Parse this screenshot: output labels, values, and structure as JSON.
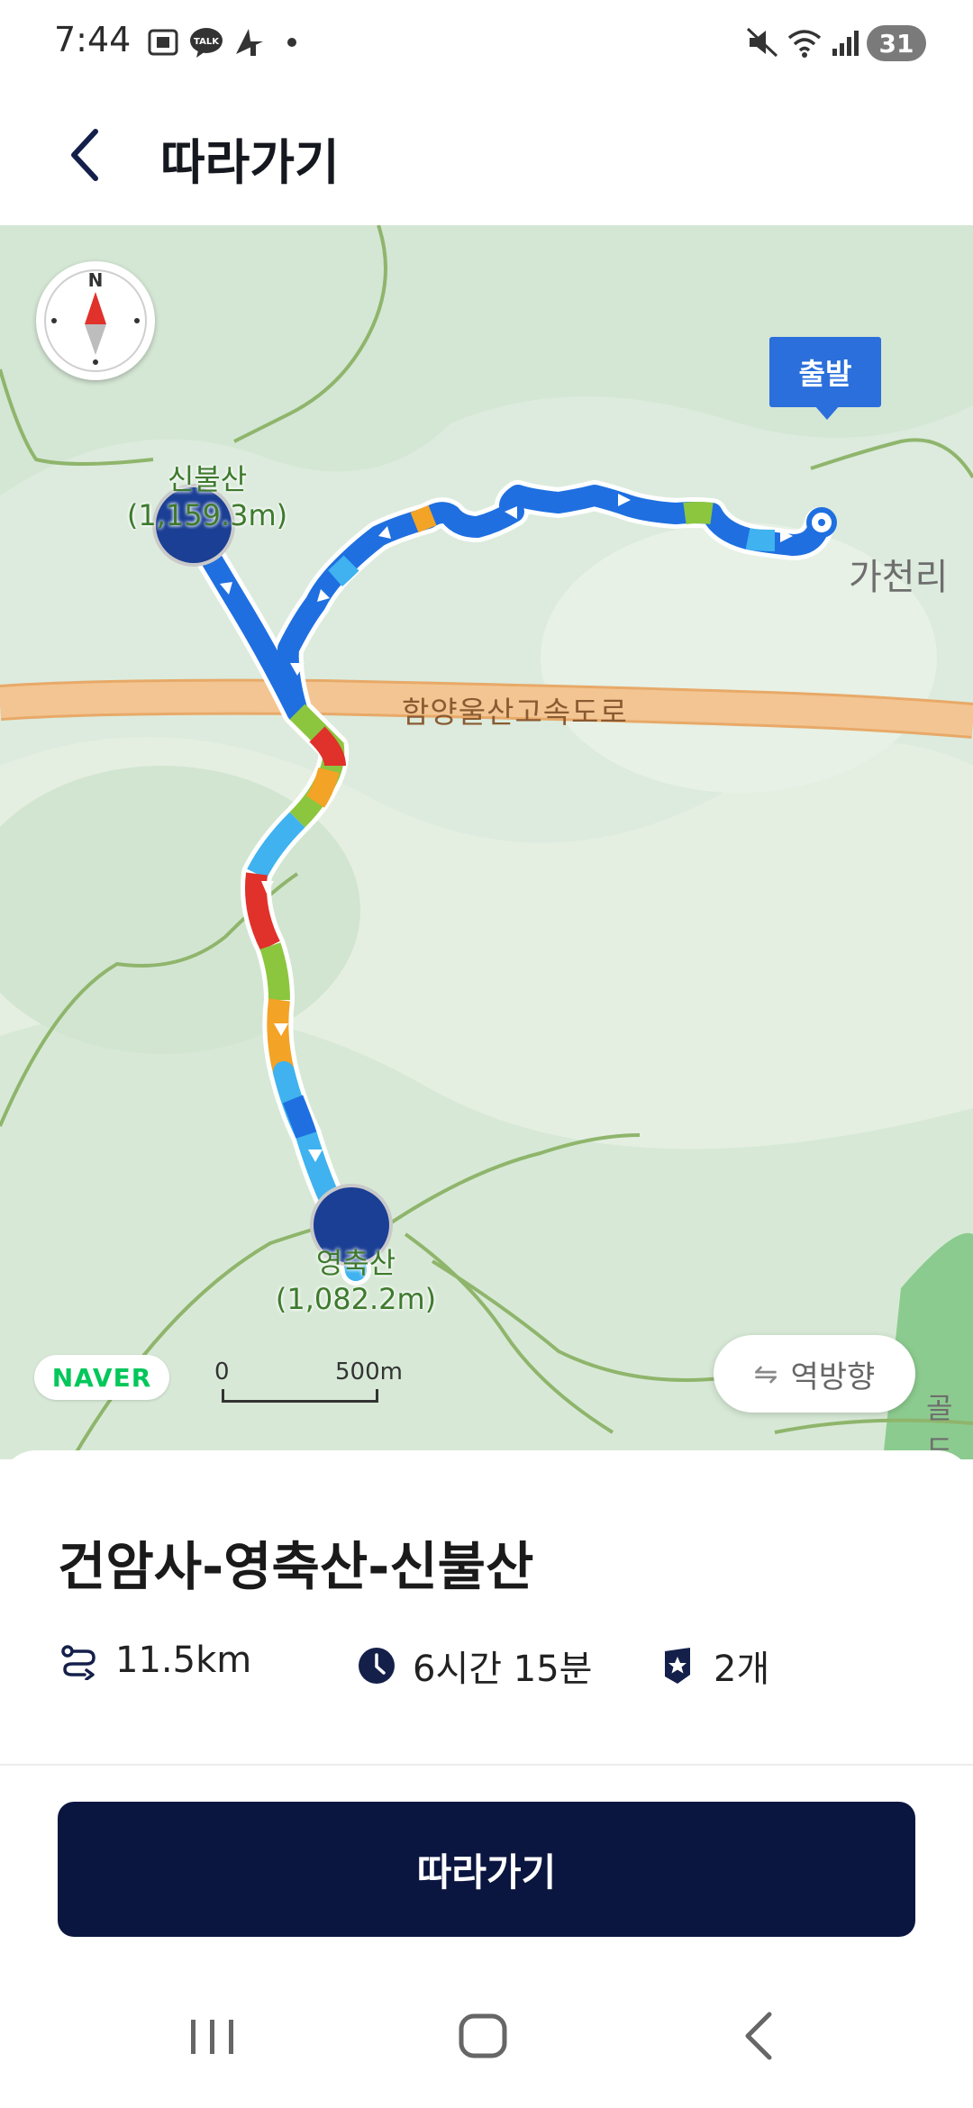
{
  "status_bar": {
    "time": "7:44",
    "icons": [
      "screenshot-icon",
      "kakaotalk-icon",
      "navigation-app-icon",
      "notification-dot-icon",
      "mute-icon",
      "wifi-icon",
      "signal-icon"
    ],
    "battery": "31"
  },
  "header": {
    "title": "따라가기",
    "back_icon": "chevron-left-icon"
  },
  "map": {
    "start_flag": "출발",
    "peak_top": {
      "name": "신불산",
      "elevation": "(1,159.3m)"
    },
    "peak_bottom": {
      "name": "영축산",
      "elevation": "(1,082.2m)"
    },
    "highway": "함양울산고속도로",
    "village": "가천리",
    "village2": "골드",
    "provider": "NAVER",
    "scale": {
      "zero": "0",
      "max": "500m"
    },
    "reverse_button": "역방향",
    "colors": {
      "route_blue": "#1f6fe0",
      "route_light": "#3fb2ef",
      "route_green": "#8cc63e",
      "route_red": "#e0312b",
      "route_orange": "#f3a326",
      "highway": "#f3c592",
      "waypoint": "#1b3f94"
    }
  },
  "course": {
    "title": "건암사-영축산-신불산",
    "distance": "11.5km",
    "duration": "6시간 15분",
    "waypoints": "2개"
  },
  "actions": {
    "follow_button": "따라가기"
  },
  "nav_bar": {
    "icons": [
      "recent-apps-icon",
      "home-icon",
      "back-icon"
    ]
  },
  "theme": {
    "primary": "#0b1640",
    "accent": "#2a6fdb"
  }
}
